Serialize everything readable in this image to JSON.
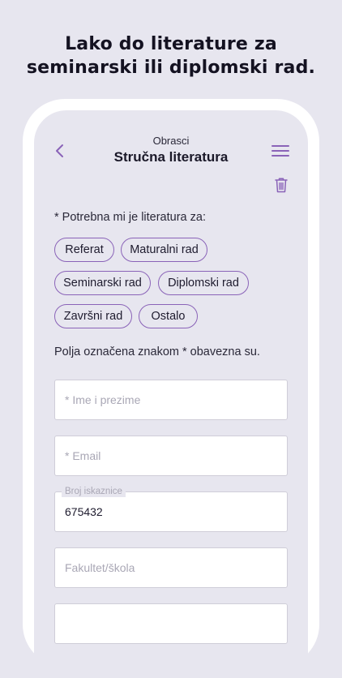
{
  "headline": {
    "line1": "Lako do literature za",
    "line2": "seminarski ili diplomski rad."
  },
  "nav": {
    "subtitle": "Obrasci",
    "title": "Stručna literatura"
  },
  "form": {
    "question_label": "* Potrebna mi je literatura za:",
    "chips": [
      "Referat",
      "Maturalni rad",
      "Seminarski rad",
      "Diplomski rad",
      "Završni rad",
      "Ostalo"
    ],
    "required_note": "Polja označena znakom * obavezna su.",
    "fields": {
      "name": {
        "placeholder": "* Ime i prezime",
        "value": ""
      },
      "email": {
        "placeholder": "* Email",
        "value": ""
      },
      "id_card": {
        "label": "Broj iskaznice",
        "value": "675432"
      },
      "faculty": {
        "placeholder": "Fakultet/škola",
        "value": ""
      }
    }
  },
  "icons": {
    "back": "chevron-left-icon",
    "menu": "hamburger-menu-icon",
    "delete": "trash-icon"
  },
  "colors": {
    "accent": "#8a63b8",
    "background": "#e7e6ef",
    "field_border": "#cfcdd8",
    "placeholder": "#a9a7b5"
  }
}
